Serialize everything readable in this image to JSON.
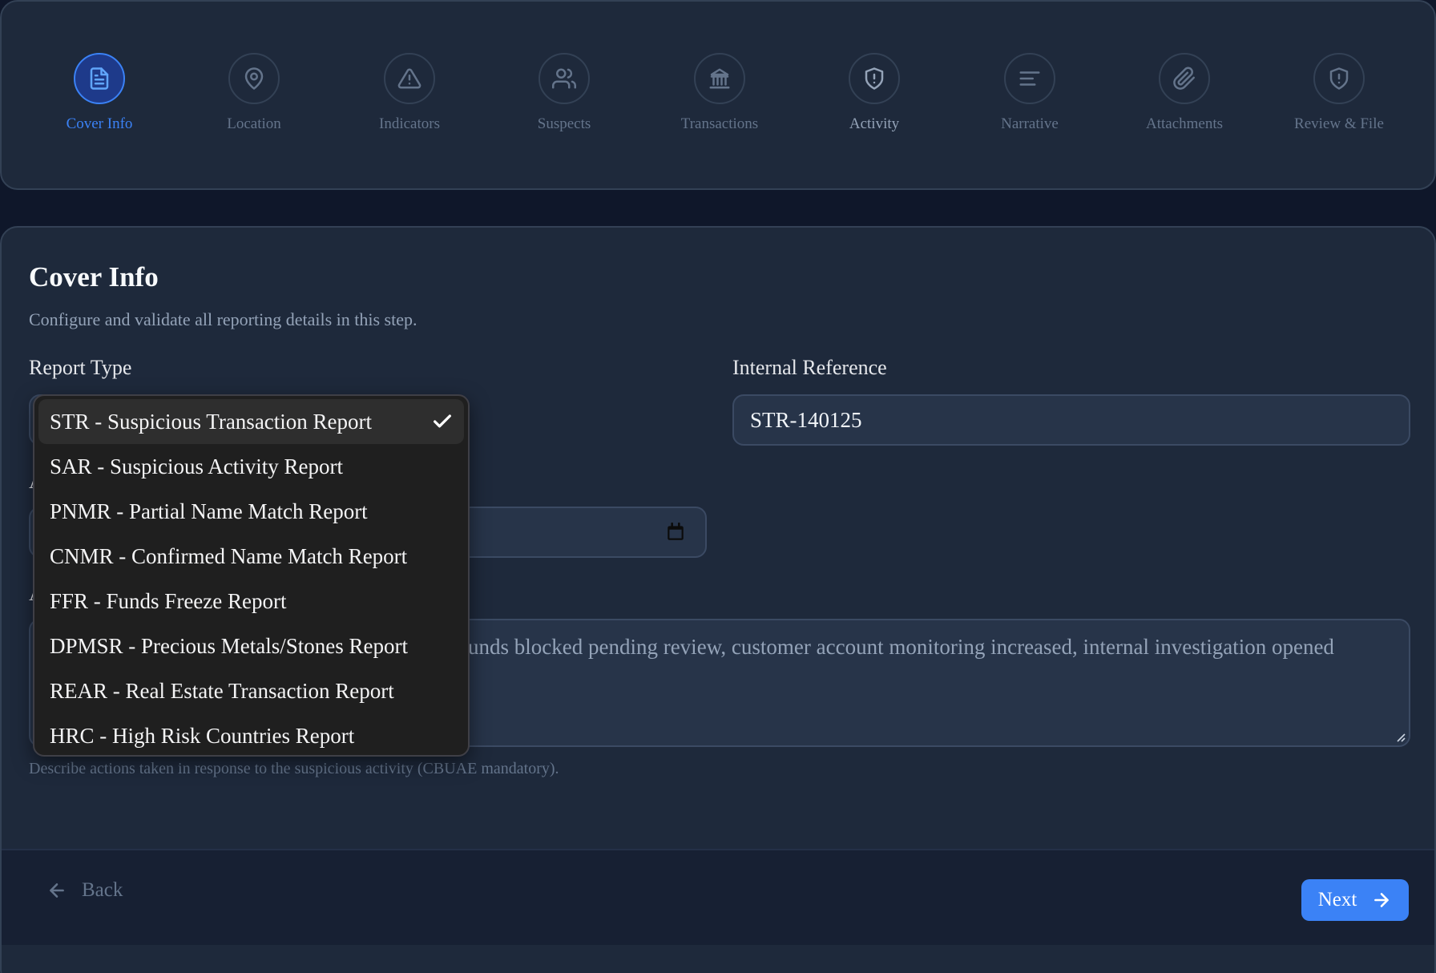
{
  "steps": [
    {
      "label": "Cover Info",
      "icon": "document-icon",
      "state": "active"
    },
    {
      "label": "Location",
      "icon": "map-pin-icon",
      "state": "inactive"
    },
    {
      "label": "Indicators",
      "icon": "warning-triangle-icon",
      "state": "inactive"
    },
    {
      "label": "Suspects",
      "icon": "users-icon",
      "state": "inactive"
    },
    {
      "label": "Transactions",
      "icon": "bank-icon",
      "state": "inactive"
    },
    {
      "label": "Activity",
      "icon": "shield-alert-icon",
      "state": "semi"
    },
    {
      "label": "Narrative",
      "icon": "text-align-icon",
      "state": "inactive"
    },
    {
      "label": "Attachments",
      "icon": "paperclip-icon",
      "state": "inactive"
    },
    {
      "label": "Review & File",
      "icon": "shield-alert-icon",
      "state": "inactive"
    }
  ],
  "form": {
    "title": "Cover Info",
    "subtitle": "Configure and validate all reporting details in this step.",
    "report_type_label": "Report Type",
    "internal_reference_label": "Internal Reference",
    "internal_reference_value": "STR-140125",
    "actions_text": "unds blocked pending review, customer account monitoring increased, internal investigation opened",
    "actions_help": "Describe actions taken in response to the suspicious activity (CBUAE mandatory).",
    "partial_label_a": "A",
    "partial_label_b": "A"
  },
  "dropdown": {
    "selected": "STR - Suspicious Transaction Report",
    "options": [
      "STR - Suspicious Transaction Report",
      "SAR - Suspicious Activity Report",
      "PNMR - Partial Name Match Report",
      "CNMR - Confirmed Name Match Report",
      "FFR - Funds Freeze Report",
      "DPMSR - Precious Metals/Stones Report",
      "REAR - Real Estate Transaction Report",
      "HRC - High Risk Countries Report"
    ]
  },
  "footer": {
    "back_label": "Back",
    "next_label": "Next"
  },
  "colors": {
    "accent": "#3b82f6",
    "background": "#0f172a",
    "card": "#1e293b"
  }
}
